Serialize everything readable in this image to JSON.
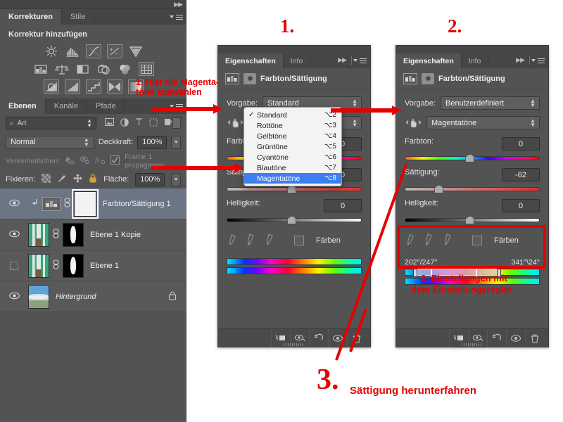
{
  "app": {
    "theme_bg": "#535353",
    "accent_red": "#e60000",
    "select_blue": "#3d7ff0"
  },
  "left_panel": {
    "adjustments": {
      "tabs": [
        {
          "label": "Korrekturen",
          "active": true
        },
        {
          "label": "Stile",
          "active": false
        }
      ],
      "title": "Korrektur hinzufügen",
      "icon_rows": [
        [
          "brightness-contrast-icon",
          "levels-icon",
          "curves-icon",
          "exposure-icon",
          "vibrance-icon"
        ],
        [
          "hue-saturation-icon",
          "color-balance-icon",
          "black-white-icon",
          "photo-filter-icon",
          "channel-mixer-icon",
          "color-lookup-icon"
        ],
        [
          "invert-icon",
          "posterize-icon",
          "threshold-icon",
          "selective-color-icon",
          "gradient-map-icon"
        ]
      ]
    },
    "layers": {
      "tabs": [
        {
          "label": "Ebenen",
          "active": true
        },
        {
          "label": "Kanäle",
          "active": false
        },
        {
          "label": "Pfade",
          "active": false
        }
      ],
      "filter": {
        "value": "Art",
        "icons": [
          "pixel-filter-icon",
          "adjustment-filter-icon",
          "text-filter-icon",
          "shape-filter-icon",
          "smart-object-filter-icon"
        ]
      },
      "blend_mode": "Normal",
      "opacity_label": "Deckkraft:",
      "opacity_value": "100%",
      "unify_label": "Vereinheitlichen:",
      "propagate_label": "Frame 1 propagieren",
      "lock_label": "Fixieren:",
      "fill_label": "Fläche:",
      "fill_value": "100%",
      "items": [
        {
          "name": "Farbton/Sättigung 1",
          "visible": true,
          "selected": true,
          "kind": "adjustment",
          "clipped": true,
          "italic": false
        },
        {
          "name": "Ebene 1 Kopie",
          "visible": true,
          "selected": false,
          "kind": "image",
          "clipped": false,
          "italic": false
        },
        {
          "name": "Ebene 1",
          "visible": false,
          "selected": false,
          "kind": "image",
          "clipped": false,
          "italic": false
        },
        {
          "name": "Hintergrund",
          "visible": true,
          "selected": false,
          "kind": "background",
          "clipped": false,
          "italic": true,
          "locked": true
        }
      ]
    }
  },
  "panel1": {
    "tabs": [
      {
        "label": "Eigenschaften",
        "active": true
      },
      {
        "label": "Info",
        "active": false
      }
    ],
    "header_title": "Farbton/Sättigung",
    "preset_label": "Vorgabe:",
    "preset_value": "Standard",
    "channel_value": "Standard",
    "hue_label": "Farbton:",
    "hue_value": "0",
    "sat_label": "Sättigung:",
    "sat_value": "0",
    "light_label": "Helligkeit:",
    "light_value": "0",
    "colorize_label": "Färben",
    "footer_icons": [
      "clip-to-layer-icon",
      "view-previous-state-icon",
      "reset-icon",
      "toggle-visibility-icon",
      "delete-icon"
    ]
  },
  "dropdown": {
    "items": [
      {
        "label": "Standard",
        "shortcut": "⌥2",
        "checked": true,
        "highlighted": false
      },
      {
        "label": "Rottöne",
        "shortcut": "⌥3",
        "checked": false,
        "highlighted": false
      },
      {
        "label": "Gelbtöne",
        "shortcut": "⌥4",
        "checked": false,
        "highlighted": false
      },
      {
        "label": "Grüntöne",
        "shortcut": "⌥5",
        "checked": false,
        "highlighted": false
      },
      {
        "label": "Cyantöne",
        "shortcut": "⌥6",
        "checked": false,
        "highlighted": false
      },
      {
        "label": "Blautöne",
        "shortcut": "⌥7",
        "checked": false,
        "highlighted": false
      },
      {
        "label": "Magentatöne",
        "shortcut": "⌥8",
        "checked": false,
        "highlighted": true
      }
    ]
  },
  "panel2": {
    "tabs": [
      {
        "label": "Eigenschaften",
        "active": true
      },
      {
        "label": "Info",
        "active": false
      }
    ],
    "header_title": "Farbton/Sättigung",
    "preset_label": "Vorgabe:",
    "preset_value": "Benutzerdefiniert",
    "channel_value": "Magentatöne",
    "hue_label": "Farbton:",
    "hue_value": "0",
    "sat_label": "Sättigung:",
    "sat_value": "-62",
    "light_label": "Helligkeit:",
    "light_value": "0",
    "colorize_label": "Färben",
    "range_left": "202°/247°",
    "range_right": "341°\\24°",
    "footer_icons": [
      "clip-to-layer-icon",
      "view-previous-state-icon",
      "reset-icon",
      "toggle-visibility-icon",
      "delete-icon"
    ]
  },
  "annotations": {
    "step1_num": "1.",
    "step2_num": "2.",
    "step3_num": "3.",
    "note1_line1": "1. Hier die Magenta-",
    "note1_line2": "töne auswählen",
    "note2_line1": "2. Einstellungen mit",
    "note2_line2": "dem Einstellungsregler",
    "note3": "Sättigung herunterfahren"
  }
}
